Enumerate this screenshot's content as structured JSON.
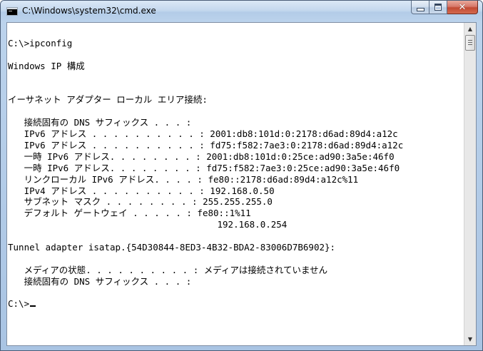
{
  "window": {
    "title": "C:\\Windows\\system32\\cmd.exe"
  },
  "caption": {
    "minimize_icon": "minimize-icon",
    "maximize_icon": "maximize-icon",
    "close_icon": "close-icon",
    "close_glyph": "✕"
  },
  "colors": {
    "console_bg": "#ffffff",
    "console_text": "#000000",
    "close_button": "#c24a33",
    "titlebar": "#bcd3ec"
  },
  "scrollbar": {
    "up_glyph": "▲",
    "down_glyph": "▼"
  },
  "console": {
    "lines": [
      "C:\\>ipconfig",
      "",
      "Windows IP 構成",
      "",
      "",
      "イーサネット アダプター ローカル エリア接続:",
      "",
      "   接続固有の DNS サフィックス . . . :",
      "   IPv6 アドレス . . . . . . . . . . : 2001:db8:101d:0:2178:d6ad:89d4:a12c",
      "   IPv6 アドレス . . . . . . . . . . : fd75:f582:7ae3:0:2178:d6ad:89d4:a12c",
      "   一時 IPv6 アドレス. . . . . . . . : 2001:db8:101d:0:25ce:ad90:3a5e:46f0",
      "   一時 IPv6 アドレス. . . . . . . . : fd75:f582:7ae3:0:25ce:ad90:3a5e:46f0",
      "   リンクローカル IPv6 アドレス. . . . : fe80::2178:d6ad:89d4:a12c%11",
      "   IPv4 アドレス . . . . . . . . . . : 192.168.0.50",
      "   サブネット マスク . . . . . . . . : 255.255.255.0",
      "   デフォルト ゲートウェイ . . . . . : fe80::1%11",
      "                                       192.168.0.254",
      "",
      "Tunnel adapter isatap.{54D30844-8ED3-4B32-BDA2-83006D7B6902}:",
      "",
      "   メディアの状態. . . . . . . . . . : メディアは接続されていません",
      "   接続固有の DNS サフィックス . . . :",
      ""
    ],
    "prompt": "C:\\>"
  }
}
